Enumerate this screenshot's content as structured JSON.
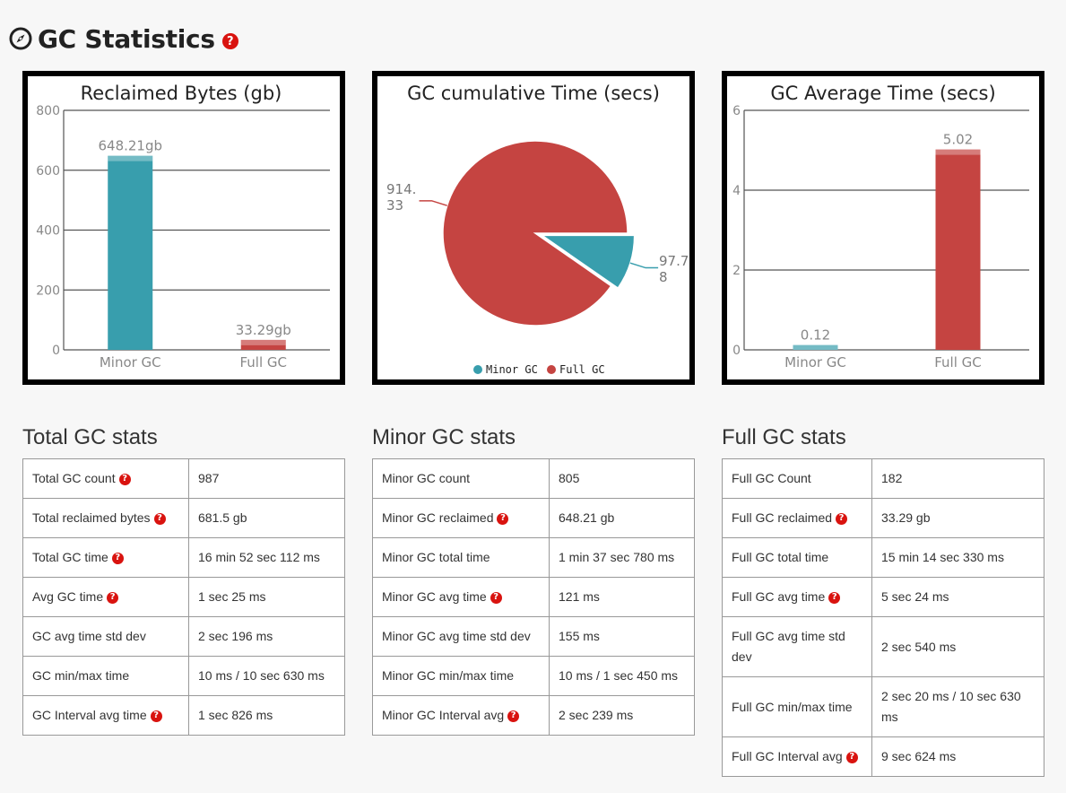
{
  "page": {
    "title": "GC Statistics",
    "help_icon": "question-circle-icon",
    "title_icon": "compass-icon"
  },
  "colors": {
    "minor": "#389ead",
    "full": "#c54441"
  },
  "charts": {
    "reclaimed": {
      "title": "Reclaimed Bytes (gb)",
      "chart_data": {
        "type": "bar",
        "title": "Reclaimed Bytes (gb)",
        "categories": [
          "Minor GC",
          "Full GC"
        ],
        "values": [
          648.21,
          33.29
        ],
        "labels": [
          "648.21gb",
          "33.29gb"
        ],
        "ylim": [
          0,
          800
        ],
        "yticks": [
          0,
          200,
          400,
          600,
          800
        ],
        "grid": true
      }
    },
    "cumulative": {
      "title": "GC cumulative Time (secs)",
      "chart_data": {
        "type": "pie",
        "title": "GC cumulative Time (secs)",
        "categories": [
          "Minor GC",
          "Full GC"
        ],
        "values": [
          97.78,
          914.33
        ],
        "legend": "bottom"
      }
    },
    "average": {
      "title": "GC Average Time (secs)",
      "chart_data": {
        "type": "bar",
        "title": "GC Average Time (secs)",
        "categories": [
          "Minor GC",
          "Full GC"
        ],
        "values": [
          0.12,
          5.02
        ],
        "labels": [
          "0.12",
          "5.02"
        ],
        "ylim": [
          0,
          6
        ],
        "yticks": [
          0,
          2,
          4,
          6
        ],
        "grid": true
      }
    }
  },
  "pie_labels": {
    "minor_line1": "97.7",
    "minor_line2": "8",
    "full_line1": "914.",
    "full_line2": "33"
  },
  "legend": {
    "minor": "Minor GC",
    "full": "Full GC"
  },
  "sections": {
    "total": {
      "title": "Total GC stats",
      "rows": [
        {
          "label": "Total GC count",
          "help": true,
          "value": "987"
        },
        {
          "label": "Total reclaimed bytes",
          "help": true,
          "value": "681.5 gb"
        },
        {
          "label": "Total GC time",
          "help": true,
          "value": "16 min 52 sec 112 ms"
        },
        {
          "label": "Avg GC time",
          "help": true,
          "value": "1 sec 25 ms"
        },
        {
          "label": "GC avg time std dev",
          "help": false,
          "value": "2 sec 196 ms"
        },
        {
          "label": "GC min/max time",
          "help": false,
          "value": "10 ms / 10 sec 630 ms"
        },
        {
          "label": "GC Interval avg time",
          "help": true,
          "value": "1 sec 826 ms"
        }
      ]
    },
    "minor": {
      "title": "Minor GC stats",
      "rows": [
        {
          "label": "Minor GC count",
          "help": false,
          "value": "805"
        },
        {
          "label": "Minor GC reclaimed",
          "help": true,
          "value": "648.21 gb"
        },
        {
          "label": "Minor GC total time",
          "help": false,
          "value": "1 min 37 sec 780 ms"
        },
        {
          "label": "Minor GC avg time",
          "help": true,
          "value": "121 ms"
        },
        {
          "label": "Minor GC avg time std dev",
          "help": false,
          "value": "155 ms"
        },
        {
          "label": "Minor GC min/max time",
          "help": false,
          "value": "10 ms / 1 sec 450 ms"
        },
        {
          "label": "Minor GC Interval avg",
          "help": true,
          "value": "2 sec 239 ms"
        }
      ]
    },
    "full": {
      "title": "Full GC stats",
      "rows": [
        {
          "label": "Full GC Count",
          "help": false,
          "value": "182"
        },
        {
          "label": "Full GC reclaimed",
          "help": true,
          "value": "33.29 gb"
        },
        {
          "label": "Full GC total time",
          "help": false,
          "value": "15 min 14 sec 330 ms"
        },
        {
          "label": "Full GC avg time",
          "help": true,
          "value": "5 sec 24 ms"
        },
        {
          "label": "Full GC avg time std dev",
          "help": false,
          "value": "2 sec 540 ms"
        },
        {
          "label": "Full GC min/max time",
          "help": false,
          "value": "2 sec 20 ms / 10 sec 630 ms"
        },
        {
          "label": "Full GC Interval avg",
          "help": true,
          "value": "9 sec 624 ms"
        }
      ]
    }
  }
}
